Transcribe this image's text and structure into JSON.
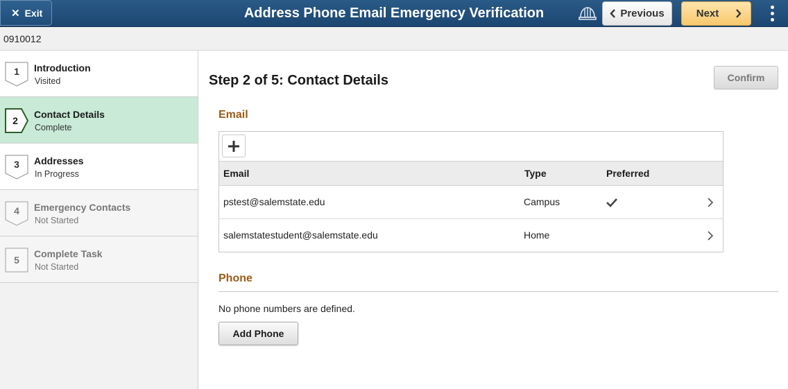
{
  "header": {
    "exit_label": "Exit",
    "title": "Address Phone Email Emergency Verification",
    "previous_label": "Previous",
    "next_label": "Next",
    "icons": [
      "close-icon",
      "helmet-icon",
      "chevron-left-icon",
      "chevron-right-icon",
      "kebab-menu-icon"
    ],
    "colors": {
      "header_bg": "#1c4672",
      "next_bg": "#f7c86c"
    }
  },
  "subbar": {
    "id_text": "0910012"
  },
  "sidebar": {
    "steps": [
      {
        "number": "1",
        "label": "Introduction",
        "status": "Visited"
      },
      {
        "number": "2",
        "label": "Contact Details",
        "status": "Complete"
      },
      {
        "number": "3",
        "label": "Addresses",
        "status": "In Progress"
      },
      {
        "number": "4",
        "label": "Emergency Contacts",
        "status": "Not Started"
      },
      {
        "number": "5",
        "label": "Complete Task",
        "status": "Not Started"
      }
    ],
    "colors": {
      "current_bg": "#c8ead6"
    }
  },
  "main": {
    "step_title": "Step 2 of 5: Contact Details",
    "confirm_label": "Confirm",
    "email": {
      "section_title": "Email",
      "columns": [
        "Email",
        "Type",
        "Preferred"
      ],
      "rows": [
        {
          "email": "pstest@salemstate.edu",
          "type": "Campus",
          "preferred": true
        },
        {
          "email": "salemstatestudent@salemstate.edu",
          "type": "Home",
          "preferred": false
        }
      ]
    },
    "phone": {
      "section_title": "Phone",
      "empty_text": "No phone numbers are defined.",
      "add_label": "Add Phone"
    },
    "colors": {
      "section_title": "#9a5a16"
    }
  }
}
